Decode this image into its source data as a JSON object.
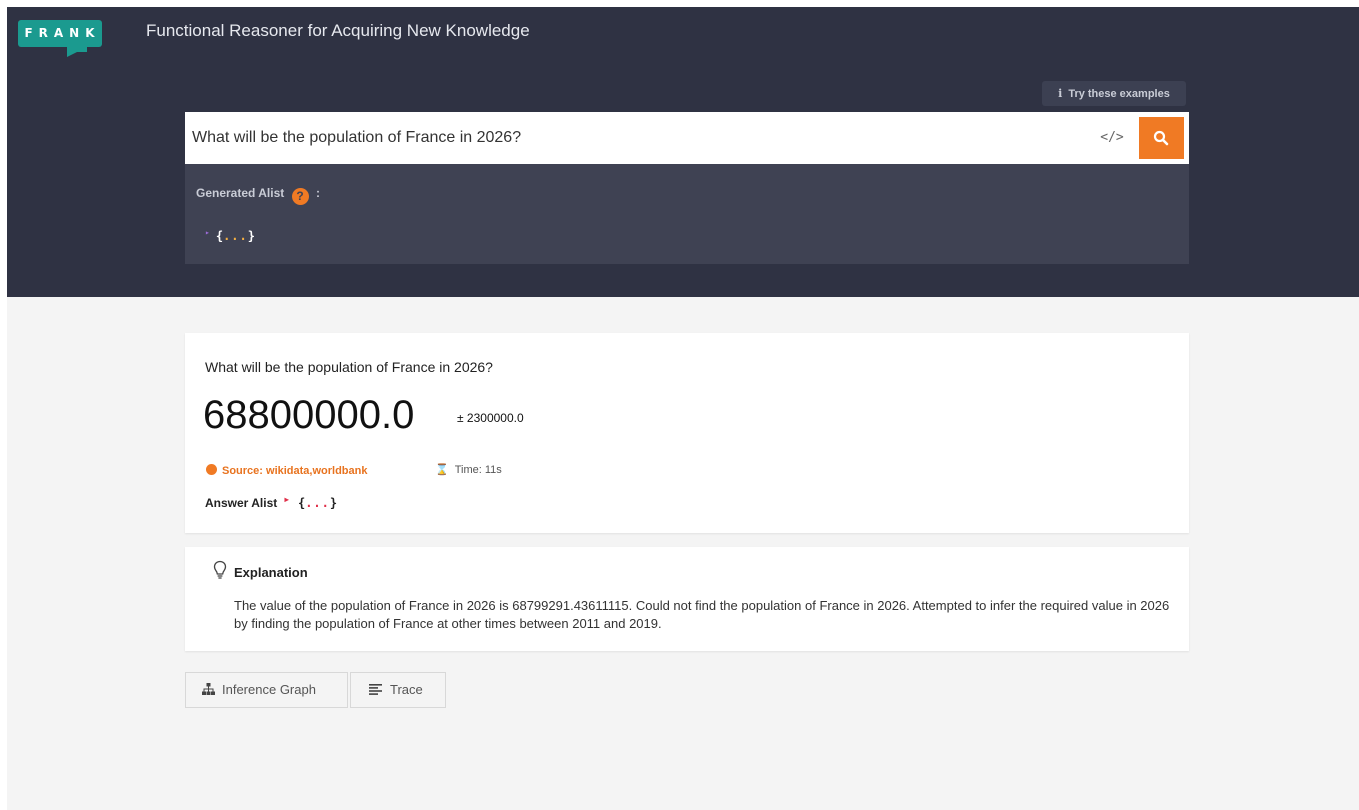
{
  "header": {
    "logo_text": "FRANK",
    "app_title": "Functional Reasoner for Acquiring New Knowledge",
    "examples_icon": "i",
    "examples_label": "Try these examples"
  },
  "search": {
    "query": "What will be the population of France in 2026?",
    "code_icon": "</>",
    "search_icon": "search-icon"
  },
  "alist_panel": {
    "label": "Generated Alist",
    "help_icon": "?",
    "colon": ":",
    "caret": "▸",
    "tree_open": "{",
    "tree_dots": "...",
    "tree_close": "}"
  },
  "answer": {
    "question": "What will be the population of France in 2026?",
    "value": "68800000.0",
    "error_bar": "± 2300000.0",
    "source": "Source: wikidata,worldbank",
    "time_label": "Time: 11s",
    "hourglass_icon": "⌛",
    "alist_label": "Answer Alist",
    "caret": "▸",
    "tree_open": "{",
    "tree_dots": "...",
    "tree_close": "}"
  },
  "explanation": {
    "title": "Explanation",
    "body": "The value of the population of France in 2026 is 68799291.43611115. Could not find the population of France in 2026. Attempted to infer the required value in 2026 by finding the population of France at other times between 2011 and 2019."
  },
  "tabs": [
    {
      "label": "Inference Graph",
      "icon": "sitemap-icon"
    },
    {
      "label": "Trace",
      "icon": "list-icon"
    }
  ],
  "colors": {
    "header_bg": "#2f3243",
    "accent": "#f07a24",
    "logo": "#1b9a8f"
  }
}
